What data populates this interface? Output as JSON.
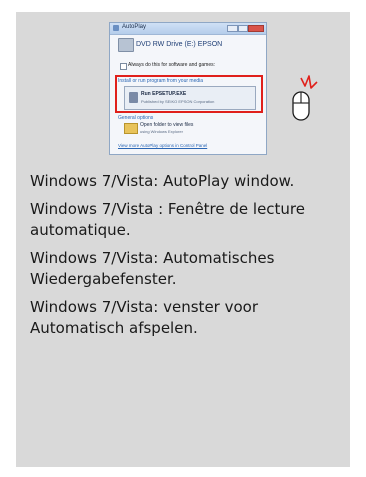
{
  "autoplay_window": {
    "title": "AutoPlay",
    "drive": "DVD RW Drive (E:) EPSON",
    "always_do": "Always do this for software and games:",
    "install_section": "Install or run program from your media",
    "run_item": "Run EPSETUP.EXE",
    "run_publisher": "Published by SEIKO EPSON Corporation",
    "general_options": "General options",
    "open_folder": "Open folder to view files",
    "open_folder_sub": "using Windows Explorer",
    "more_link": "View more AutoPlay options in Control Panel"
  },
  "captions": [
    "Windows 7/Vista: AutoPlay window.",
    "Windows 7/Vista : Fenêtre de lecture automatique.",
    "Windows 7/Vista: Automatisches Wiedergabefenster.",
    "Windows 7/Vista: venster voor Automatisch afspelen."
  ],
  "colors": {
    "panel": "#d9d9d9",
    "highlight": "#e0201b",
    "link": "#2a66b4"
  }
}
